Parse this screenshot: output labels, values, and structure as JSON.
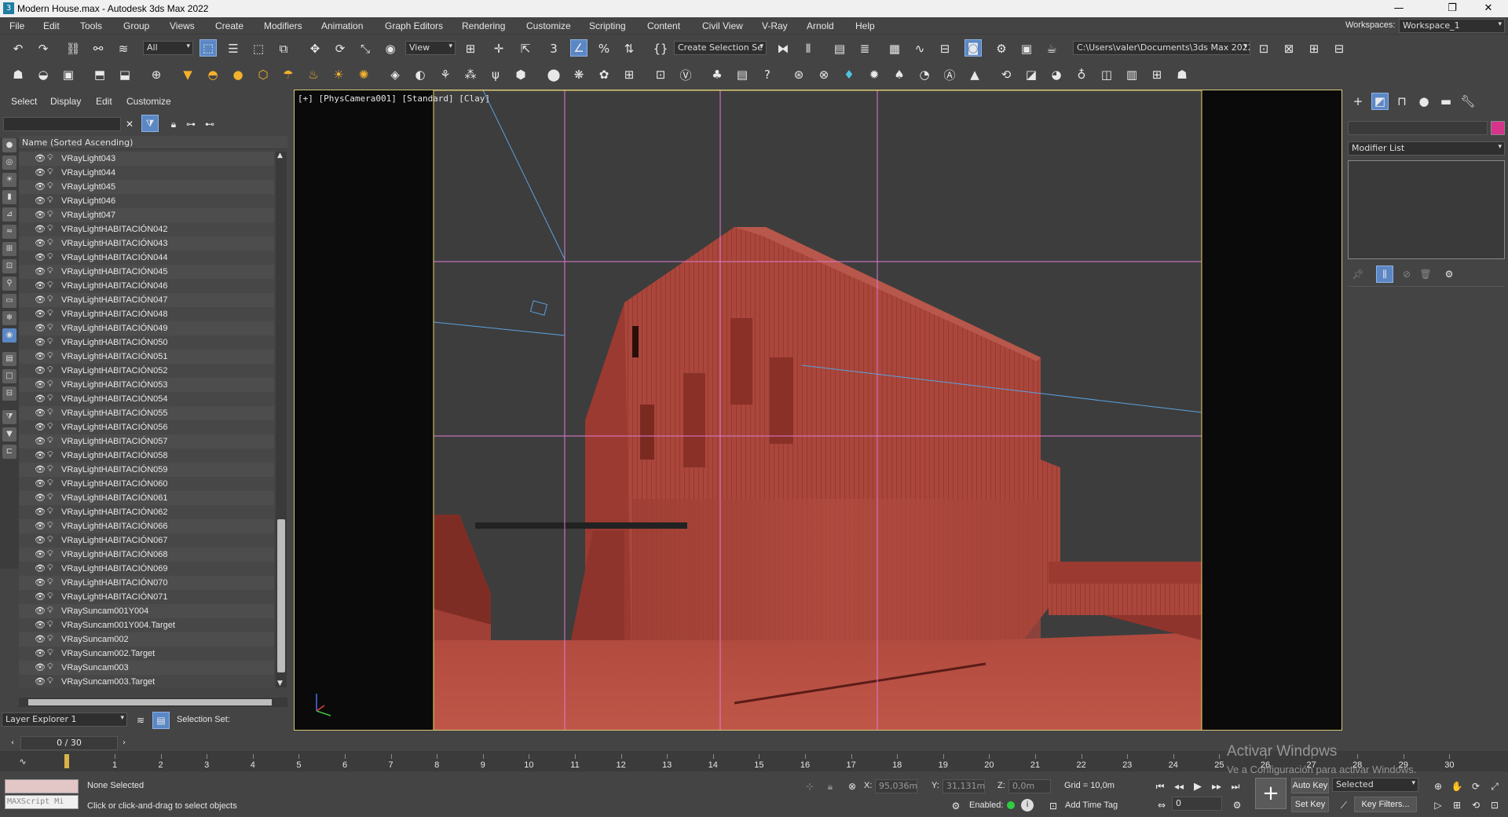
{
  "window": {
    "title": "Modern House.max - Autodesk 3ds Max 2022",
    "minimize": "—",
    "restore": "❐",
    "close": "✕"
  },
  "menu": {
    "items": [
      "File",
      "Edit",
      "Tools",
      "Group",
      "Views",
      "Create",
      "Modifiers",
      "Animation",
      "Graph Editors",
      "Rendering",
      "Customize",
      "Scripting",
      "Content",
      "Civil View",
      "V-Ray",
      "Arnold",
      "Help"
    ],
    "workspaces_label": "Workspaces:",
    "workspace_value": "Workspace_1"
  },
  "toolbar": {
    "filter_value": "All",
    "refcoord_value": "View",
    "selection_set_placeholder": "Create Selection Se",
    "project_path": "C:\\Users\\valer\\Documents\\3ds Max 2022"
  },
  "scene_explorer": {
    "tabs": [
      "Select",
      "Display",
      "Edit",
      "Customize"
    ],
    "column_header": "Name (Sorted Ascending)",
    "rows": [
      "VRayLight043",
      "VRayLight044",
      "VRayLight045",
      "VRayLight046",
      "VRayLight047",
      "VRayLightHABITACIÓN042",
      "VRayLightHABITACIÓN043",
      "VRayLightHABITACIÓN044",
      "VRayLightHABITACIÓN045",
      "VRayLightHABITACIÓN046",
      "VRayLightHABITACIÓN047",
      "VRayLightHABITACIÓN048",
      "VRayLightHABITACIÓN049",
      "VRayLightHABITACIÓN050",
      "VRayLightHABITACIÓN051",
      "VRayLightHABITACIÓN052",
      "VRayLightHABITACIÓN053",
      "VRayLightHABITACIÓN054",
      "VRayLightHABITACIÓN055",
      "VRayLightHABITACIÓN056",
      "VRayLightHABITACIÓN057",
      "VRayLightHABITACIÓN058",
      "VRayLightHABITACIÓN059",
      "VRayLightHABITACIÓN060",
      "VRayLightHABITACIÓN061",
      "VRayLightHABITACIÓN062",
      "VRayLightHABITACIÓN066",
      "VRayLightHABITACIÓN067",
      "VRayLightHABITACIÓN068",
      "VRayLightHABITACIÓN069",
      "VRayLightHABITACIÓN070",
      "VRayLightHABITACIÓN071",
      "VRaySuncam001Y004",
      "VRaySuncam001Y004.Target",
      "VRaySuncam002",
      "VRaySuncam002.Target",
      "VRaySuncam003",
      "VRaySuncam003.Target"
    ],
    "layer_explorer_value": "Layer Explorer 1",
    "selection_set_label": "Selection Set:"
  },
  "viewport": {
    "label": "[+] [PhysCamera001] [Standard] [Clay]"
  },
  "command_panel": {
    "modifier_list": "Modifier List"
  },
  "timeline": {
    "frame_counter": "0 / 30",
    "ticks": [
      "1",
      "2",
      "3",
      "4",
      "5",
      "6",
      "7",
      "8",
      "9",
      "10",
      "11",
      "12",
      "13",
      "14",
      "15",
      "16",
      "17",
      "18",
      "19",
      "20",
      "21",
      "22",
      "23",
      "24",
      "25",
      "26",
      "27",
      "28",
      "29",
      "30"
    ]
  },
  "status": {
    "maxscript": "MAXScript Mi",
    "none_selected": "None Selected",
    "prompt": "Click or click-and-drag to select objects",
    "x_label": "X:",
    "x_value": "95,036m",
    "y_label": "Y:",
    "y_value": "31,131m",
    "z_label": "Z:",
    "z_value": "0,0m",
    "grid": "Grid = 10,0m",
    "enabled_label": "Enabled:",
    "add_time_tag": "Add Time Tag",
    "auto_key": "Auto Key",
    "set_key": "Set Key",
    "selected_value": "Selected",
    "key_filters": "Key Filters...",
    "current_frame": "0"
  },
  "watermark": {
    "line1": "Activar Windows",
    "line2": "Ve a Configuración para activar Windows."
  },
  "colors": {
    "clay": "#a9473c",
    "viewport_bg": "#3c3c3c",
    "selection_blue": "#5b87c5",
    "swatch_pink": "#d6348a"
  }
}
